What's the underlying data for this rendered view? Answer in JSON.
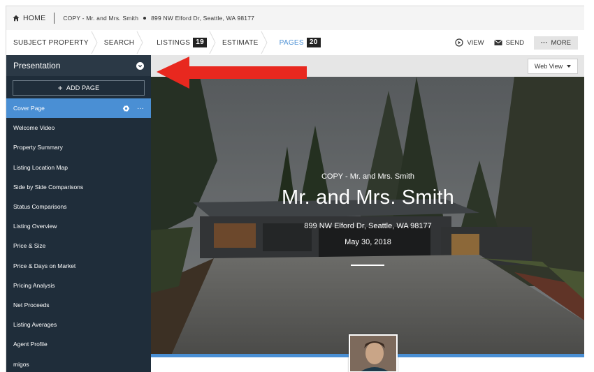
{
  "topbar": {
    "home_label": "HOME",
    "presentation_title": "COPY - Mr. and Mrs. Smith",
    "address": "899 NW Elford Dr, Seattle, WA 98177"
  },
  "nav": {
    "items": [
      {
        "label": "SUBJECT PROPERTY",
        "badge": null
      },
      {
        "label": "SEARCH",
        "badge": null
      },
      {
        "label": "LISTINGS",
        "badge": "19"
      },
      {
        "label": "ESTIMATE",
        "badge": null
      },
      {
        "label": "PAGES",
        "badge": "20"
      }
    ],
    "view_label": "VIEW",
    "send_label": "SEND",
    "more_label": "MORE"
  },
  "sidebar": {
    "title": "Presentation",
    "add_page_label": "ADD PAGE",
    "items": [
      {
        "label": "Cover Page"
      },
      {
        "label": "Welcome Video"
      },
      {
        "label": "Property Summary"
      },
      {
        "label": "Listing Location Map"
      },
      {
        "label": "Side by Side Comparisons"
      },
      {
        "label": "Status Comparisons"
      },
      {
        "label": "Listing Overview"
      },
      {
        "label": "Price & Size"
      },
      {
        "label": "Price & Days on Market"
      },
      {
        "label": "Pricing Analysis"
      },
      {
        "label": "Net Proceeds"
      },
      {
        "label": "Listing Averages"
      },
      {
        "label": "Agent Profile"
      },
      {
        "label": "migos"
      }
    ],
    "more_glyph": "···"
  },
  "content": {
    "view_mode_label": "Web View",
    "hero": {
      "subtitle": "COPY - Mr. and Mrs. Smith",
      "title": "Mr. and Mrs. Smith",
      "address": "899 NW Elford Dr, Seattle, WA 98177",
      "date": "May 30, 2018"
    }
  },
  "colors": {
    "accent": "#4a8fd4",
    "sidebar_bg": "#1f2d3a",
    "arrow": "#e8281f"
  }
}
